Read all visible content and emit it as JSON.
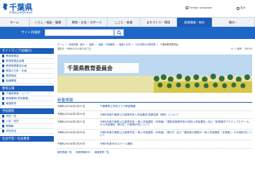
{
  "header": {
    "logo_text": "千葉県",
    "logo_sub": "chiba prefecture",
    "foreign": "Foreign Language",
    "size": "拡大",
    "colors": {
      "brand": "#1a5cb8",
      "nav_active": "#1a5cb8",
      "search_bg": "#1e66c8"
    }
  },
  "nav": {
    "items": [
      {
        "label": "ホーム"
      },
      {
        "label": "くらし・福祉・健康"
      },
      {
        "label": "教育・文化・スポーツ"
      },
      {
        "label": "しごと・産業"
      },
      {
        "label": "まちづくり・環境"
      },
      {
        "label": "県政情報・統計"
      },
      {
        "label": "観光・"
      }
    ]
  },
  "search": {
    "label": "サイト内検索",
    "placeholder": ""
  },
  "breadcrumb": [
    "ホーム",
    "県政情報・統計",
    "組織",
    "組織・行政機構",
    "組織と仕事",
    "公共分野の行政事業",
    "千葉県教育委員会"
  ],
  "sidebar": {
    "sections": [
      {
        "title": "サイトマップ(組織内)",
        "items": [
          "教育委員会",
          "教育委員会会議",
          "教育振興基本計画",
          "教育の方針・計画",
          "教育施設",
          "各種事業"
        ]
      },
      {
        "title": "教育広報",
        "items": [
          "千葉県教育・リーフ",
          "教育関係(学校事業)",
          "報道発表"
        ]
      },
      {
        "title": "学校教育",
        "items": [
          "学校一覧",
          "入試・就学",
          "教職員",
          "学校安全"
        ]
      },
      {
        "title": "生涯学習・社会教育",
        "items": []
      }
    ]
  },
  "main": {
    "updated": "更新日：令和6(2024)年2月27日",
    "page_id": "ページ番号：3/6150",
    "title": "千葉県教育委員会",
    "news_title": "新着情報",
    "news": [
      {
        "date": "令和6(2024)年2月27日",
        "text": "千葉県県立学校スマホ教室開催"
      },
      {
        "date": "令和6(2024)年2月22日",
        "text": "令和6年度千葉県公立高等学校入学者選抜 検査結果（理科）について"
      },
      {
        "date": "令和6(2024)年2月21日",
        "text": "令和6年度千葉県公立高等学校 一般入学者選抜（本検査）「選抜実施等学校の特別入学者選抜」及び「新規進学アクティブスクール」の入学者選抜（第2日）の受検状況について"
      },
      {
        "date": "令和6(2024)年2月20日",
        "text": "令和6年度千葉県公立高等学校 一般入学者選抜（本検査）（第1日）及び「通信制の課程の一般入学者選抜（本検査）」の欠席状況について"
      },
      {
        "date": "令和6(2024)年2月20日",
        "text": "令和6年度UDAスクール通信"
      }
    ],
    "links": [
      "新着情報一覧",
      "新着情報RSS",
      "報道発表一覧"
    ]
  }
}
